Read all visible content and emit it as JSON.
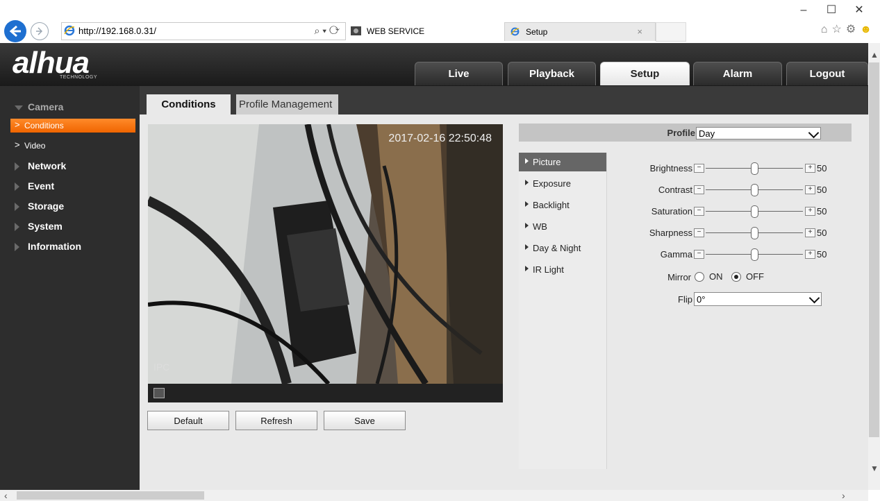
{
  "browser": {
    "url": "http://192.168.0.31/",
    "tabs": [
      {
        "label": "WEB SERVICE"
      },
      {
        "label": "Setup",
        "close": "×"
      }
    ],
    "window_controls": {
      "minimize": "–",
      "maximize": "☐",
      "close": "✕"
    },
    "address_tools": "⌕ ▾ ⟳"
  },
  "app": {
    "logo": "alhua",
    "logo_sub": "TECHNOLOGY",
    "nav": [
      {
        "label": "Live"
      },
      {
        "label": "Playback"
      },
      {
        "label": "Setup"
      },
      {
        "label": "Alarm"
      },
      {
        "label": "Logout"
      }
    ],
    "active_nav": "Setup"
  },
  "sidebar": {
    "items": [
      {
        "label": "Camera",
        "expanded": true
      },
      {
        "label": "Network"
      },
      {
        "label": "Event"
      },
      {
        "label": "Storage"
      },
      {
        "label": "System"
      },
      {
        "label": "Information"
      }
    ],
    "subitems": [
      {
        "label": "Conditions",
        "chevron": ">",
        "active": true
      },
      {
        "label": "Video",
        "chevron": ">"
      }
    ]
  },
  "content": {
    "tabs": [
      {
        "label": "Conditions"
      },
      {
        "label": "Profile Management"
      }
    ],
    "video": {
      "timestamp": "2017-02-16 22:50:48",
      "channel": "IPC"
    },
    "buttons": {
      "default": "Default",
      "refresh": "Refresh",
      "save": "Save"
    },
    "profile": {
      "label": "Profile",
      "value": "Day"
    },
    "menu": [
      {
        "label": "Picture",
        "active": true
      },
      {
        "label": "Exposure"
      },
      {
        "label": "Backlight"
      },
      {
        "label": "WB"
      },
      {
        "label": "Day & Night"
      },
      {
        "label": "IR Light"
      }
    ],
    "sliders": [
      {
        "label": "Brightness",
        "value": "50",
        "level": 0.5
      },
      {
        "label": "Contrast",
        "value": "50",
        "level": 0.5
      },
      {
        "label": "Saturation",
        "value": "50",
        "level": 0.5
      },
      {
        "label": "Sharpness",
        "value": "50",
        "level": 0.5
      },
      {
        "label": "Gamma",
        "value": "50",
        "level": 0.5
      }
    ],
    "mirror": {
      "label": "Mirror",
      "on_label": "ON",
      "off_label": "OFF",
      "selected": "OFF"
    },
    "flip": {
      "label": "Flip",
      "value": "0°"
    }
  },
  "colors": {
    "accent": "#f06500",
    "sidebar": "#2d2d2d",
    "header": "#1a1a1a"
  }
}
